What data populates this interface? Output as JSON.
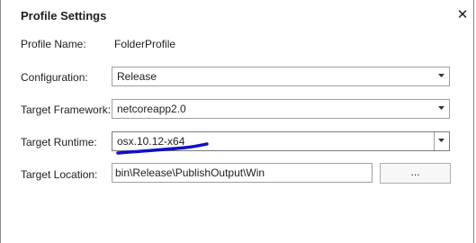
{
  "dialog": {
    "title": "Profile Settings",
    "close_glyph": "✕"
  },
  "fields": {
    "profile_name": {
      "label": "Profile Name:",
      "value": "FolderProfile"
    },
    "configuration": {
      "label": "Configuration:",
      "value": "Release"
    },
    "target_framework": {
      "label": "Target Framework:",
      "value": "netcoreapp2.0"
    },
    "target_runtime": {
      "label": "Target Runtime:",
      "value": "osx.10.12-x64"
    },
    "target_location": {
      "label": "Target Location:",
      "value": "bin\\Release\\PublishOutput\\Win"
    }
  },
  "browse_button": {
    "label": "..."
  },
  "annotation": {
    "color": "#1010c8"
  },
  "icons": {
    "close": "close-icon",
    "dropdown": "chevron-down-icon"
  }
}
